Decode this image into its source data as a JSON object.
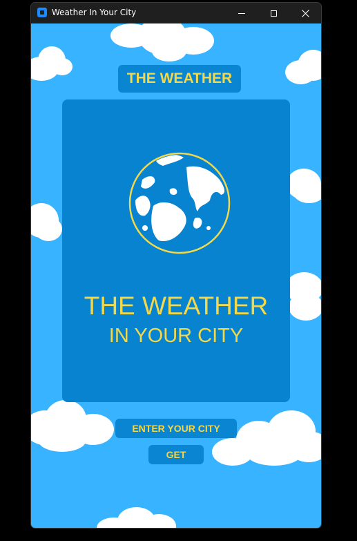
{
  "window": {
    "title": "Weather In Your City"
  },
  "header": {
    "badge_text": "THE WEATHER"
  },
  "card": {
    "title": "THE WEATHER",
    "subtitle": "IN YOUR CITY",
    "image_icon": "globe-icon"
  },
  "form": {
    "city_placeholder": "ENTER YOUR CITY",
    "city_value": "",
    "get_label": "GET"
  },
  "colors": {
    "sky": "#37b3ff",
    "panel": "#0883d0",
    "accent_text": "#f2d84b"
  }
}
